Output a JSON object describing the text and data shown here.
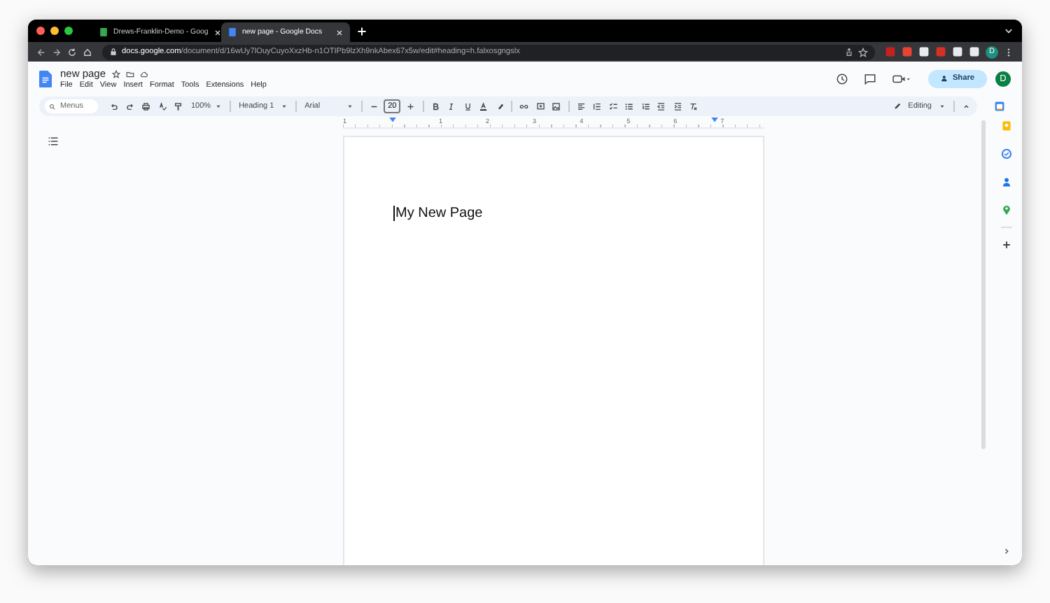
{
  "browser": {
    "tabs": [
      {
        "title": "Drews-Franklin-Demo - Goog",
        "selected": false
      },
      {
        "title": "new page - Google Docs",
        "selected": true
      }
    ],
    "url": {
      "host": "docs.google.com",
      "path": "/document/d/16wUy7lOuyCuyoXxzHb-n1OTIPb9lzXh9nkAbex67x5w/edit#heading=h.falxosgngslx"
    },
    "profile": "D"
  },
  "doc": {
    "title": "new page",
    "menus": [
      "File",
      "Edit",
      "View",
      "Insert",
      "Format",
      "Tools",
      "Extensions",
      "Help"
    ],
    "share": "Share",
    "avatar": "D"
  },
  "toolbar": {
    "search": {
      "placeholder": "Menus"
    },
    "zoom": "100%",
    "style": "Heading 1",
    "font": "Arial",
    "font_size": "20",
    "mode": "Editing"
  },
  "ruler": [
    "1",
    "1",
    "2",
    "3",
    "4",
    "5",
    "6",
    "7"
  ],
  "page": {
    "heading": "My New Page"
  }
}
